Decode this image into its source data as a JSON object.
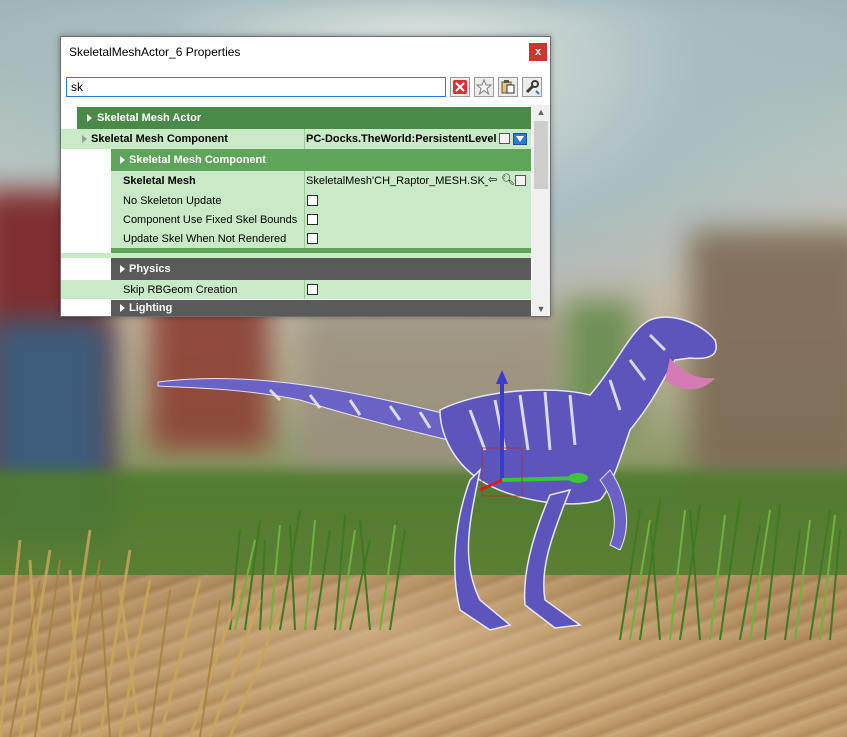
{
  "window": {
    "title": "SkeletalMeshActor_6 Properties",
    "close_label": "x"
  },
  "search": {
    "value": "sk"
  },
  "toolbar": {
    "buttons": [
      "clear-search-icon",
      "favorite-star-icon",
      "paste-clipboard-icon",
      "tools-wrench-icon"
    ]
  },
  "properties": {
    "category_actor": "Skeletal Mesh Actor",
    "component_label": "Skeletal Mesh Component",
    "component_value": "PC-Docks.TheWorld:PersistentLevel",
    "subcategory_component": "Skeletal Mesh Component",
    "skeletal_mesh_label": "Skeletal Mesh",
    "skeletal_mesh_value": "SkeletalMesh'CH_Raptor_MESH.SK_Raptor'",
    "checkbox_rows": [
      {
        "label": "No Skeleton Update",
        "checked": false
      },
      {
        "label": "Component Use Fixed Skel Bounds",
        "checked": false
      },
      {
        "label": "Update Skel When Not Rendered",
        "checked": false
      }
    ],
    "category_physics": "Physics",
    "skip_rbgeom_label": "Skip RBGeom Creation",
    "skip_rbgeom_checked": false,
    "category_lighting": "Lighting"
  },
  "colors": {
    "category_green": "#4a8a48",
    "subcategory_green": "#5ea55a",
    "row_green": "#c8eac6",
    "category_gray": "#5a5a5a",
    "accent_blue": "#2f7bcf"
  }
}
